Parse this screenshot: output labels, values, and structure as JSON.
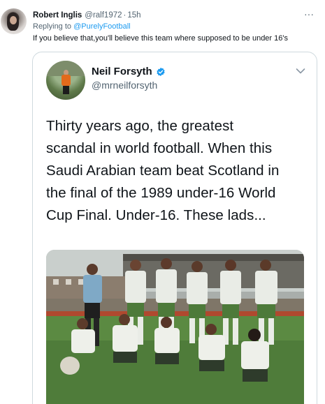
{
  "reply": {
    "author_name": "Robert Inglis",
    "author_handle": "@ralf1972",
    "separator": "·",
    "time": "15h",
    "more_glyph": "···",
    "replying_prefix": "Replying to",
    "replying_to": "@PurelyFootball",
    "text": "If you believe that,you'll believe this team where supposed to be under 16's",
    "icons": [
      "avatar",
      "more-icon"
    ]
  },
  "quoted": {
    "author_name": "Neil Forsyth",
    "author_handle": "@mrneilforsyth",
    "lines": [
      "Thirty years ago, the greatest",
      "scandal in world football. When this",
      "Saudi Arabian team beat Scotland in",
      "the final of the 1989 under-16 World",
      "Cup Final. Under-16. These lads..."
    ],
    "icons": [
      "verified-badge-icon",
      "chevron-down-icon"
    ],
    "media": "team-photo"
  },
  "colors": {
    "text": "#0f1419",
    "muted": "#536471",
    "link": "#1d9bf0",
    "border": "#cfd9de"
  }
}
